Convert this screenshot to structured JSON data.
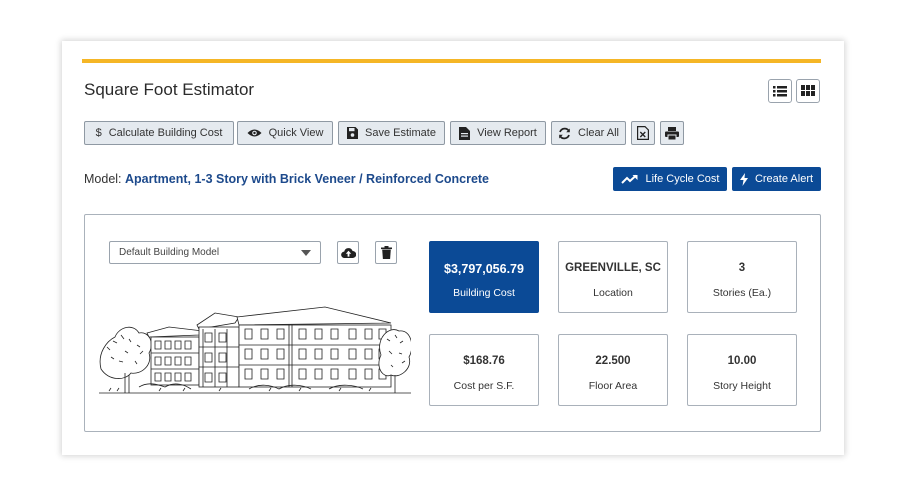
{
  "page": {
    "title": "Square Foot Estimator"
  },
  "view_toggle": {
    "list_icon": "list-icon",
    "grid_icon": "grid-icon"
  },
  "toolbar": {
    "calculate_label": "Calculate Building Cost",
    "calculate_icon": "$",
    "quick_view_label": "Quick View",
    "save_label": "Save Estimate",
    "report_label": "View Report",
    "clear_label": "Clear All"
  },
  "model": {
    "label": "Model:",
    "value": "Apartment, 1-3 Story with Brick Veneer / Reinforced Concrete"
  },
  "actions": {
    "life_cycle_label": "Life Cycle Cost",
    "alert_label": "Create Alert"
  },
  "building": {
    "model_select_value": "Default Building Model"
  },
  "stats": [
    {
      "value": "$3,797,056.79",
      "label": "Building Cost"
    },
    {
      "value": "GREENVILLE, SC",
      "label": "Location"
    },
    {
      "value": "3",
      "label": "Stories (Ea.)"
    },
    {
      "value": "$168.76",
      "label": "Cost per S.F."
    },
    {
      "value": "22.500",
      "label": "Floor Area"
    },
    {
      "value": "10.00",
      "label": "Story Height"
    }
  ],
  "colors": {
    "accent": "#f5b626",
    "primary": "#0b4a96",
    "link": "#1d4a8c"
  }
}
